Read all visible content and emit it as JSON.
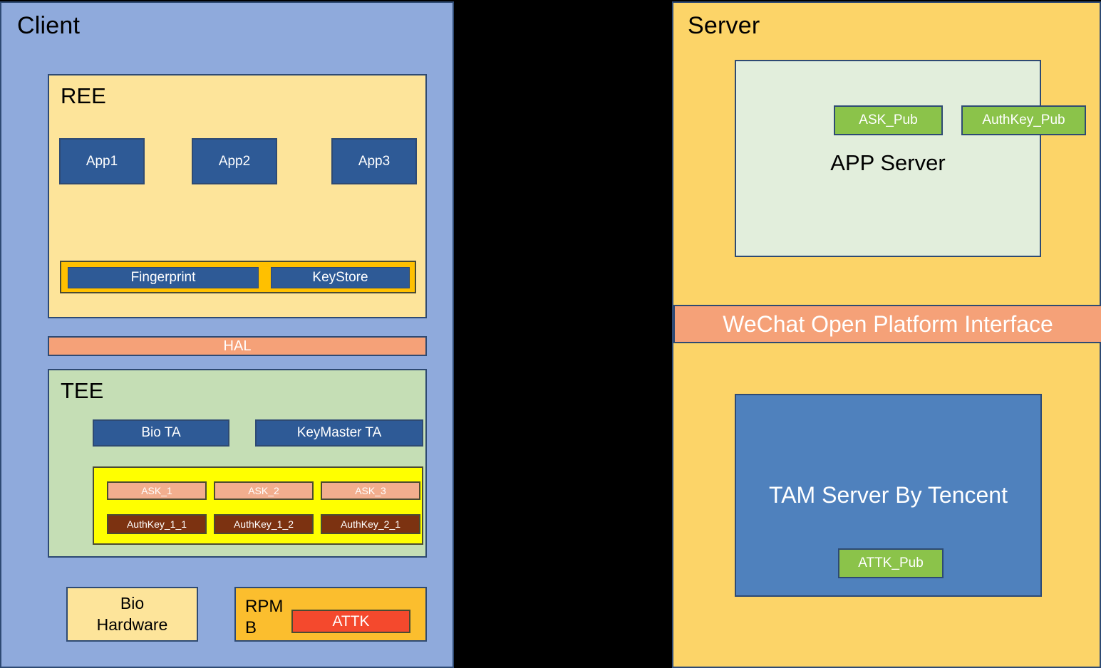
{
  "diagram": {
    "background_color": "#000000"
  },
  "client": {
    "title": "Client",
    "background_color": "#8FAADC",
    "ree": {
      "label": "REE",
      "background_color": "#FDE49A",
      "apps": [
        {
          "label": "App1"
        },
        {
          "label": "App2"
        },
        {
          "label": "App3"
        }
      ],
      "services_group": {
        "background_color": "#FFC000",
        "items": [
          {
            "label": "Fingerprint"
          },
          {
            "label": "KeyStore"
          }
        ]
      }
    },
    "hal": {
      "label": "HAL",
      "background_color": "#F5A178"
    },
    "tee": {
      "label": "TEE",
      "background_color": "#C5DEB5",
      "trusted_apps": [
        {
          "label": "Bio TA"
        },
        {
          "label": "KeyMaster TA"
        }
      ],
      "key_vault": {
        "background_color": "#FFFF00",
        "ask_keys": [
          {
            "label": "ASK_1"
          },
          {
            "label": "ASK_2"
          },
          {
            "label": "ASK_3"
          }
        ],
        "auth_keys": [
          {
            "label": "AuthKey_1_1"
          },
          {
            "label": "AuthKey_1_2"
          },
          {
            "label": "AuthKey_2_1"
          }
        ]
      }
    },
    "hardware": {
      "bio_hardware_line1": "Bio",
      "bio_hardware_line2": "Hardware",
      "rpmb_line1": "RPM",
      "rpmb_line2": "B",
      "rpmb_key": "ATTK",
      "rpmb_key_color": "#F4492D"
    }
  },
  "server": {
    "title": "Server",
    "background_color": "#FCD468",
    "app_server": {
      "title": "APP Server",
      "background_color": "#E2EEDC",
      "public_keys": [
        {
          "label": "ASK_Pub"
        },
        {
          "label": "AuthKey_Pub"
        }
      ],
      "key_color": "#8BC34A"
    },
    "interface_band": {
      "label": "WeChat Open Platform Interface",
      "background_color": "#F5A178"
    },
    "tam_server": {
      "title": "TAM Server By Tencent",
      "background_color": "#4F81BD",
      "public_key": "ATTK_Pub"
    }
  }
}
